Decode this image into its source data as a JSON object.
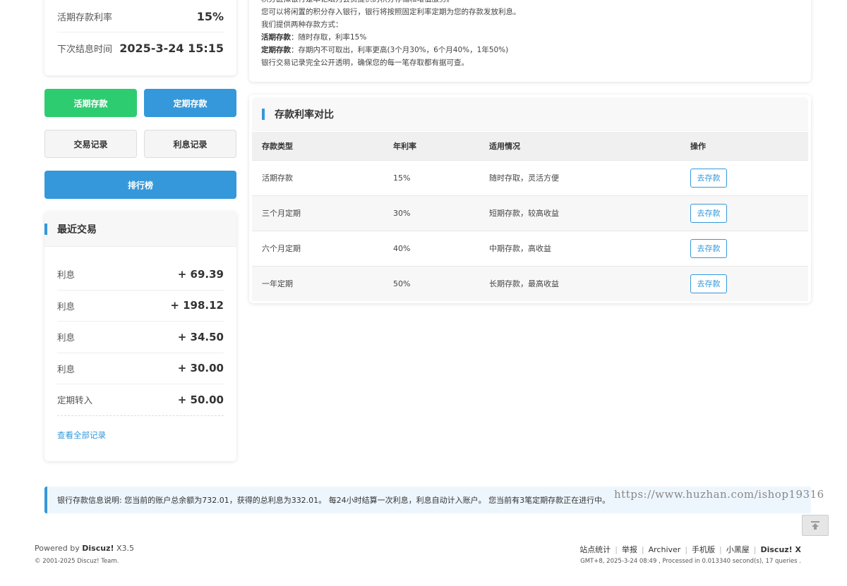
{
  "account": {
    "rate_label": "活期存款利率",
    "rate_value": "15%",
    "next_label": "下次结息时间",
    "next_value": "2025-3-24 15:15"
  },
  "actions": {
    "current_deposit": "活期存款",
    "fixed_deposit": "定期存款",
    "transactions": "交易记录",
    "interest_records": "利息记录",
    "ranking": "排行榜"
  },
  "recent": {
    "title": "最近交易",
    "items": [
      {
        "label": "利息",
        "amount": "+ 69.39"
      },
      {
        "label": "利息",
        "amount": "+ 198.12"
      },
      {
        "label": "利息",
        "amount": "+ 34.50"
      },
      {
        "label": "利息",
        "amount": "+ 30.00"
      },
      {
        "label": "定期转入",
        "amount": "+ 50.00"
      }
    ],
    "view_all": "查看全部记录"
  },
  "intro": {
    "line0": "积分医拟银行是本论坛为会员提供的积分存储和增值服务。",
    "line1": "您可以将闲置的积分存入银行，银行将按照固定利率定期为您的存款发放利息。",
    "line2": "我们提供两种存款方式：",
    "line3_bold": "活期存款",
    "line3_rest": "：随时存取，利率15%",
    "line4_bold": "定期存款",
    "line4_rest": "：存期内不可取出，利率更高(3个月30%，6个月40%，1年50%)",
    "line5": "银行交易记录完全公开透明，确保您的每一笔存取都有据可查。"
  },
  "rates": {
    "title": "存款利率对比",
    "headers": {
      "type": "存款类型",
      "rate": "年利率",
      "usage": "适用情况",
      "action": "操作"
    },
    "rows": [
      {
        "type": "活期存款",
        "rate": "15%",
        "usage": "随时存取，灵活方便",
        "action": "去存款"
      },
      {
        "type": "三个月定期",
        "rate": "30%",
        "usage": "短期存款，较高收益",
        "action": "去存款"
      },
      {
        "type": "六个月定期",
        "rate": "40%",
        "usage": "中期存款，高收益",
        "action": "去存款"
      },
      {
        "type": "一年定期",
        "rate": "50%",
        "usage": "长期存款，最高收益",
        "action": "去存款"
      }
    ]
  },
  "notice": "银行存款信息说明: 您当前的账户总余额为732.01，获得的总利息为332.01。 每24小时结算一次利息，利息自动计入账户。 您当前有3笔定期存款正在进行中。",
  "watermark": "https://www.huzhan.com/ishop19316",
  "footer": {
    "powered_prefix": "Powered by ",
    "powered_brand": "Discuz!",
    "powered_version": " X3.5",
    "copyright": "© 2001-2025 Discuz! Team.",
    "links": [
      "站点统计",
      "举报",
      "Archiver",
      "手机版",
      "小黑屋"
    ],
    "brand": "Discuz! X",
    "stats": "GMT+8, 2025-3-24 08:49 , Processed in 0.013340 second(s), 17 queries ."
  },
  "icons": {
    "back_to_top": "arrow-up-to-line-icon"
  },
  "colors": {
    "green": "#2ecc71",
    "blue": "#3498db",
    "info_bg": "#eef6fd"
  }
}
